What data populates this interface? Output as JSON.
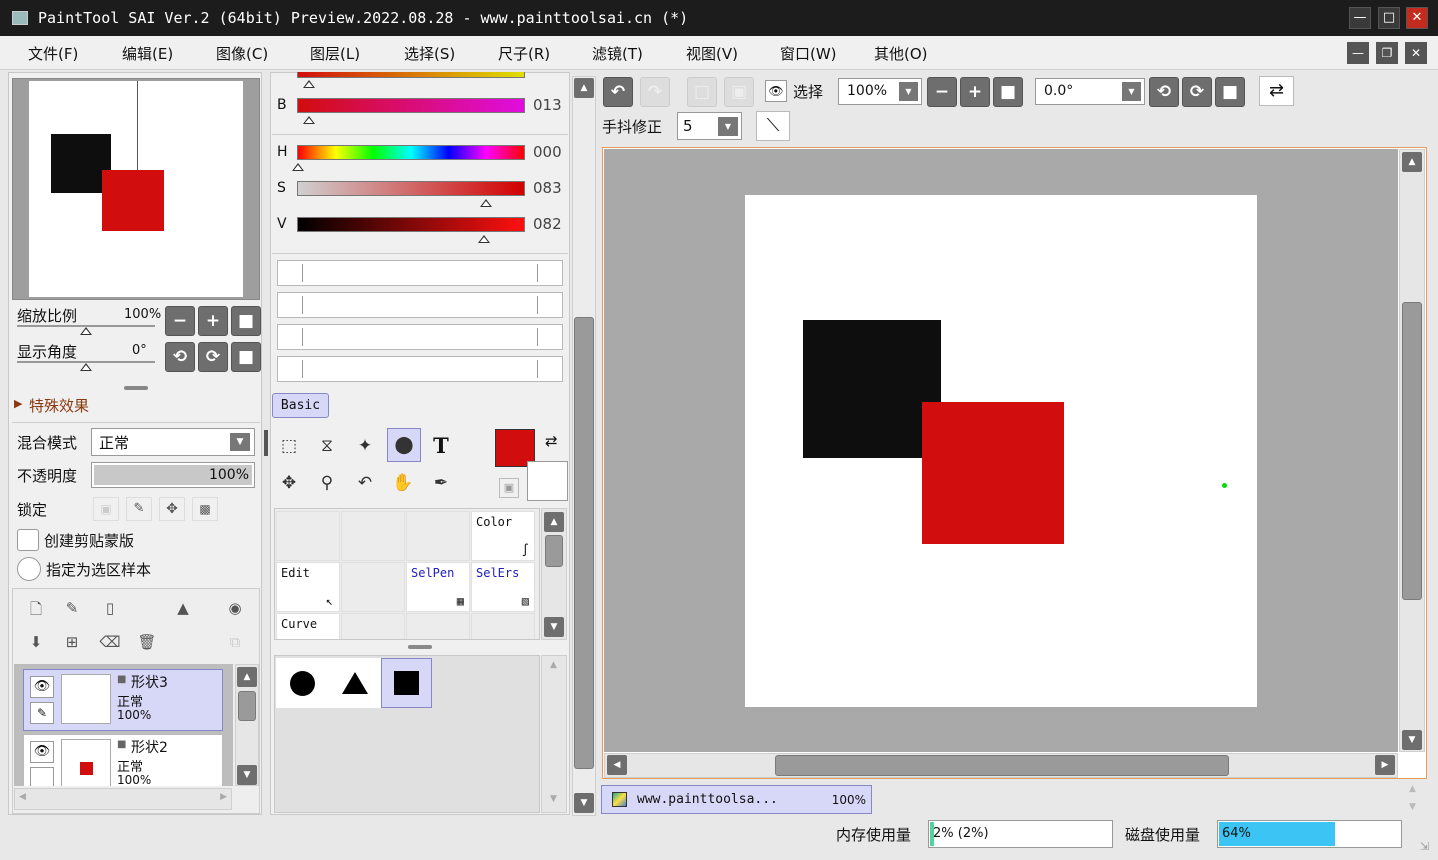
{
  "window": {
    "title": "PaintTool SAI Ver.2 (64bit) Preview.2022.08.28 - www.painttoolsai.cn (*)",
    "controls": {
      "minimize": "—",
      "maximize": "□",
      "close": "✕"
    }
  },
  "menu": {
    "items": [
      "文件(F)",
      "编辑(E)",
      "图像(C)",
      "图层(L)",
      "选择(S)",
      "尺子(R)",
      "滤镜(T)",
      "视图(V)",
      "窗口(W)",
      "其他(O)"
    ]
  },
  "navigator": {
    "zoom_label": "缩放比例",
    "zoom_value": "100%",
    "angle_label": "显示角度",
    "angle_value": "0°"
  },
  "effects": {
    "label": "特殊效果"
  },
  "layer_props": {
    "blend_label": "混合模式",
    "blend_value": "正常",
    "opacity_label": "不透明度",
    "opacity_value": "100%",
    "opacity_fraction": 1.0,
    "lock_label": "锁定",
    "clip_label": "创建剪贴蒙版",
    "sample_label": "指定为选区样本"
  },
  "layers": [
    {
      "name": "形状3",
      "mode": "正常",
      "opacity": "100%",
      "selected": true
    },
    {
      "name": "形状2",
      "mode": "正常",
      "opacity": "100%",
      "selected": false
    }
  ],
  "color": {
    "B": {
      "label": "B",
      "value": "013"
    },
    "H": {
      "label": "H",
      "value": "000"
    },
    "S": {
      "label": "S",
      "value": "083"
    },
    "V": {
      "label": "V",
      "value": "082"
    },
    "primary": "#d20d0d",
    "secondary": "#ffffff"
  },
  "tools": {
    "set_name": "Basic",
    "text_tool": "T"
  },
  "brushes": {
    "items": [
      {
        "label": "Color",
        "kind": "normal"
      },
      {
        "label": "Edit",
        "kind": "normal"
      },
      {
        "label": "SelPen",
        "kind": "sel"
      },
      {
        "label": "SelErs",
        "kind": "sel"
      },
      {
        "label": "Curve",
        "kind": "normal"
      }
    ]
  },
  "toolbar": {
    "select_label": "选择",
    "zoom_value": "100%",
    "angle_value": "0.0°",
    "stabilizer_label": "手抖修正",
    "stabilizer_value": "5"
  },
  "canvas_tab": {
    "name": "www.painttoolsa...",
    "zoom": "100%"
  },
  "status": {
    "memory_label": "内存使用量",
    "memory_value": "2% (2%)",
    "memory_fraction": 0.02,
    "disk_label": "磁盘使用量",
    "disk_value": "64%",
    "disk_fraction": 0.64
  }
}
